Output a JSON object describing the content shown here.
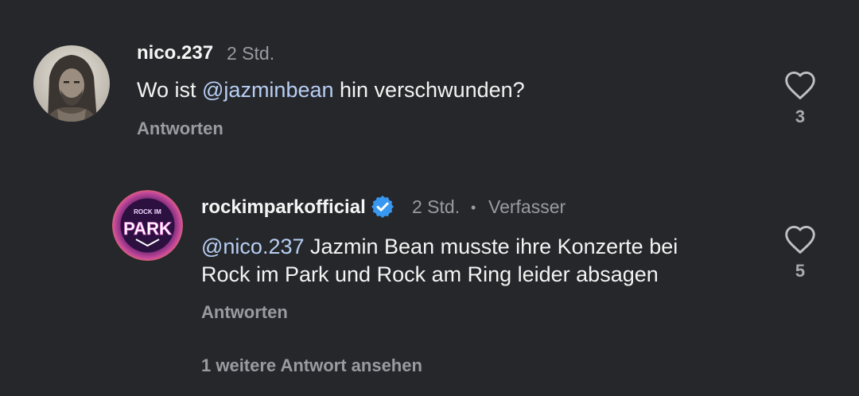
{
  "comment": {
    "username": "nico.237",
    "time": "2 Std.",
    "text_prefix": "Wo ist ",
    "mention": "@jazminbean",
    "text_suffix": " hin verschwunden?",
    "reply_label": "Antworten",
    "likes": "3"
  },
  "reply": {
    "username": "rockimparkofficial",
    "time": "2 Std.",
    "separator": "•",
    "author_badge": "Verfasser",
    "mention": "@nico.237",
    "text_line1_rest": " Jazmin Bean musste ihre Konzerte bei",
    "text_line2": "Rock im Park und Rock am Ring leider absagen",
    "reply_label": "Antworten",
    "likes": "5",
    "avatar_logo_top": "ROCK IM",
    "avatar_logo_main": "PARK"
  },
  "more_replies_label": "1 weitere Antwort ansehen",
  "icons": {
    "heart": "heart-icon",
    "verified": "verified-badge-icon"
  },
  "colors": {
    "background": "#26272b",
    "mention": "#b7cff4",
    "verified": "#3897f0"
  }
}
